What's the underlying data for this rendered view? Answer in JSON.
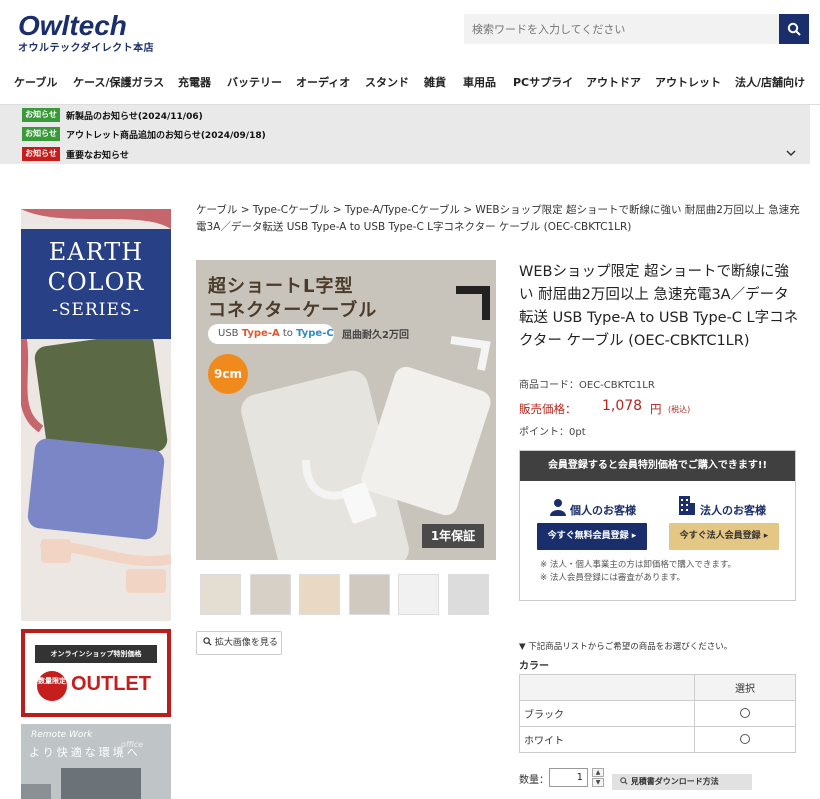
{
  "header": {
    "logo_main": "Owltech",
    "logo_sub": "オウルテックダイレクト本店",
    "search_placeholder": "検索ワードを入力してください"
  },
  "nav": [
    "ケーブル",
    "ケース/保護ガラス",
    "充電器",
    "バッテリー",
    "オーディオ",
    "スタンド",
    "雑貨",
    "車用品",
    "PCサプライ",
    "アウトドア",
    "アウトレット",
    "法人/店舗向け"
  ],
  "notices": [
    {
      "badge": "お知らせ",
      "text": "新製品のお知らせ(2024/11/06)",
      "color": "#3a9a3a"
    },
    {
      "badge": "お知らせ",
      "text": "アウトレット商品追加のお知らせ(2024/09/18)",
      "color": "#3a9a3a"
    },
    {
      "badge": "お知らせ",
      "text": "重要なお知らせ",
      "color": "#c61d1d"
    }
  ],
  "banners": {
    "earth_line1": "EARTH",
    "earth_line2": "COLOR",
    "earth_line3": "-SERIES-",
    "outlet_top": "オンラインショップ特別価格",
    "outlet_circle": "数量限定",
    "outlet_word": "OUTLET",
    "remote_title": "Remote Work",
    "remote_jp": "より快適な環境へ",
    "remote_office": "office"
  },
  "breadcrumb": "ケーブル > Type-Cケーブル > Type-A/Type-Cケーブル > WEBショップ限定 超ショートで断線に強い 耐屈曲2万回以上 急速充電3A／データ転送 USB Type-A to USB Type-C L字コネクター ケーブル (OEC-CBKTC1LR)",
  "main_image": {
    "title1": "超ショートL字型",
    "title2": "コネクターケーブル",
    "pill_prefix": "USB ",
    "pill_a": "Type-A",
    "pill_to": " to ",
    "pill_c": "Type-C",
    "flex": "屈曲耐久2万回",
    "length": "9cm",
    "warranty": "1年保証"
  },
  "zoom_label": "拡大画像を見る",
  "product": {
    "title": "WEBショップ限定 超ショートで断線に強い 耐屈曲2万回以上 急速充電3A／データ転送 USB Type-A to USB Type-C L字コネクター ケーブル (OEC-CBKTC1LR)",
    "code": "商品コード：OEC-CBKTC1LR",
    "price_label": "販売価格：",
    "price": "1,078",
    "yen": "円",
    "tax": "(税込)",
    "point": "ポイント：0pt"
  },
  "member": {
    "header": "会員登録すると会員特別価格でご購入できます!!",
    "personal_label": "個人のお客様",
    "corporate_label": "法人のお客様",
    "personal_button": "今すぐ無料会員登録 ▸",
    "corporate_button": "今すぐ法人会員登録 ▸",
    "note1": "※ 法人・個人事業主の方は卸価格で購入できます。",
    "note2": "※ 法人会員登録には審査があります。"
  },
  "selection": {
    "note": "▼ 下記商品リストからご希望の商品をお選びください。",
    "color_label": "カラー",
    "col_select": "選択",
    "options": [
      "ブラック",
      "ホワイト"
    ]
  },
  "quantity": {
    "label": "数量：",
    "value": "1",
    "download": "見積書ダウンロード方法"
  }
}
